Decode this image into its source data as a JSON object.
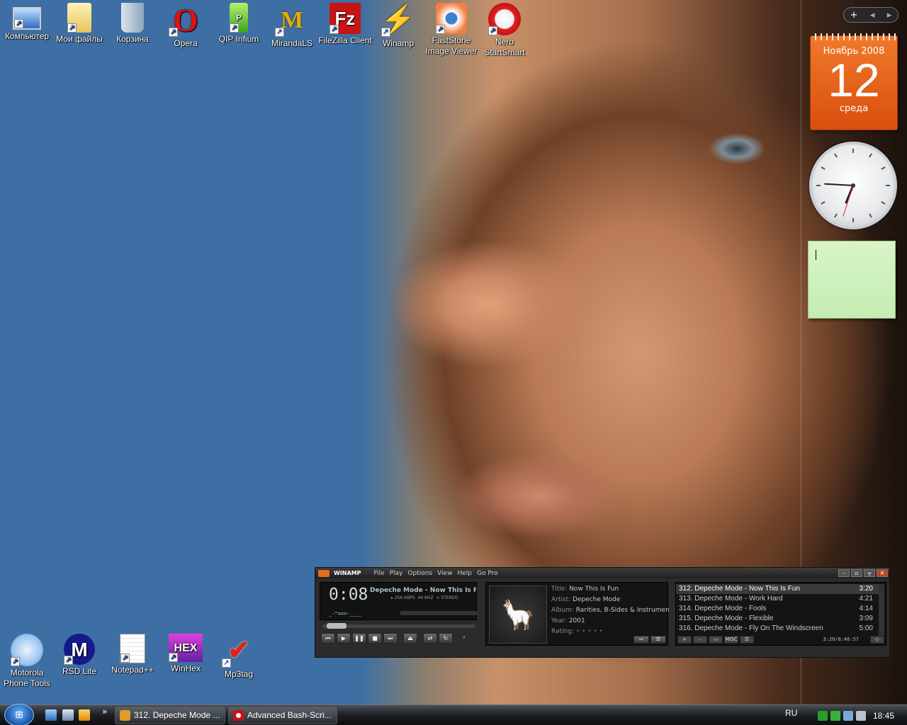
{
  "desktop": {
    "top_icons": [
      {
        "label": "Компьютер",
        "icon": "computer-icon"
      },
      {
        "label": "Мои файлы",
        "icon": "folder-icon"
      },
      {
        "label": "Корзина",
        "icon": "recycle-bin-icon"
      },
      {
        "label": "Opera",
        "icon": "opera-icon"
      },
      {
        "label": "QIP Infium",
        "icon": "qip-icon"
      },
      {
        "label": "MirandaLS",
        "icon": "miranda-icon"
      },
      {
        "label": "FileZilla Client",
        "icon": "filezilla-icon"
      },
      {
        "label": "Winamp",
        "icon": "winamp-icon"
      },
      {
        "label": "FastStone Image Viewer",
        "icon": "faststone-icon"
      },
      {
        "label": "Nero StartSmart",
        "icon": "nero-icon"
      }
    ],
    "bottom_icons": [
      {
        "label": "Motorola Phone Tools",
        "icon": "motorola-phone-tools-icon"
      },
      {
        "label": "RSD Lite",
        "icon": "motorola-logo-icon"
      },
      {
        "label": "Notepad++",
        "icon": "notepad-icon"
      },
      {
        "label": "WinHex",
        "icon": "winhex-icon"
      },
      {
        "label": "Mp3tag",
        "icon": "mp3tag-icon"
      }
    ]
  },
  "gadgets": {
    "calendar": {
      "month_year": "Ноябрь 2008",
      "day": "12",
      "weekday": "среда"
    },
    "clock": {
      "hour": 6,
      "minute": 45,
      "second": 33
    }
  },
  "winamp": {
    "brand": "WINAMP",
    "menu": [
      "File",
      "Play",
      "Options",
      "View",
      "Help",
      "Go Pro"
    ],
    "time": "0:08",
    "song": "Depeche Mode - Now This Is Fun",
    "bitrate": "256",
    "khz": "44",
    "stereo": "STEREO",
    "meta": {
      "title_label": "Title:",
      "title": "Now This Is Fun",
      "artist_label": "Artist:",
      "artist": "Depeche Mode",
      "album_label": "Album:",
      "album": "Rarities, B-Sides & Instrumentals",
      "year_label": "Year:",
      "year": "2001",
      "rating_label": "Rating:",
      "rating": "• • • • •"
    },
    "playlist": [
      {
        "title": "312. Depeche Mode - Now This Is Fun",
        "duration": "3:20",
        "selected": true
      },
      {
        "title": "313. Depeche Mode - Work Hard",
        "duration": "4:21"
      },
      {
        "title": "314. Depeche Mode - Fools",
        "duration": "4:14"
      },
      {
        "title": "315. Depeche Mode - Flexible",
        "duration": "3:09"
      },
      {
        "title": "316. Depeche Mode - Fly On The Windscreen",
        "duration": "5:00"
      }
    ],
    "playlist_total": "3:20/8:46:57",
    "playlist_misc": "MISC"
  },
  "taskbar": {
    "buttons": [
      {
        "label": "312. Depeche Mode ...",
        "icon": "winamp-icon"
      },
      {
        "label": "Advanced Bash-Scri...",
        "icon": "opera-icon"
      }
    ],
    "lang": "RU",
    "time": "18:45",
    "chevron": "»"
  },
  "colors": {
    "accent": "#e36e1e",
    "desktop_blue": "#3e6fa4",
    "calendar_orange": "#e9661f"
  }
}
